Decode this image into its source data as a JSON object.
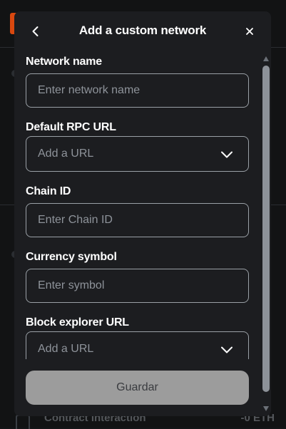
{
  "background": {
    "row_label": "Contract interaction",
    "row_value": "-0 ETH"
  },
  "modal": {
    "title": "Add a custom network",
    "back_icon": "chevron-left-icon",
    "close_icon": "close-icon"
  },
  "form": {
    "network_name": {
      "label": "Network name",
      "placeholder": "Enter network name",
      "value": ""
    },
    "rpc_url": {
      "label": "Default RPC URL",
      "placeholder": "Add a URL",
      "value": "",
      "icon": "chevron-down-icon"
    },
    "chain_id": {
      "label": "Chain ID",
      "placeholder": "Enter Chain ID",
      "value": ""
    },
    "currency_symbol": {
      "label": "Currency symbol",
      "placeholder": "Enter symbol",
      "value": ""
    },
    "block_explorer_url": {
      "label": "Block explorer URL",
      "placeholder": "Add a URL",
      "value": "",
      "icon": "chevron-down-icon"
    }
  },
  "actions": {
    "save_label": "Guardar",
    "save_enabled": false
  },
  "colors": {
    "modal_bg": "#1c1d20",
    "input_border": "#9aa0a6",
    "placeholder": "#8e939a",
    "disabled_button_bg": "#9c9c9c",
    "brand_accent": "#d9480f"
  }
}
